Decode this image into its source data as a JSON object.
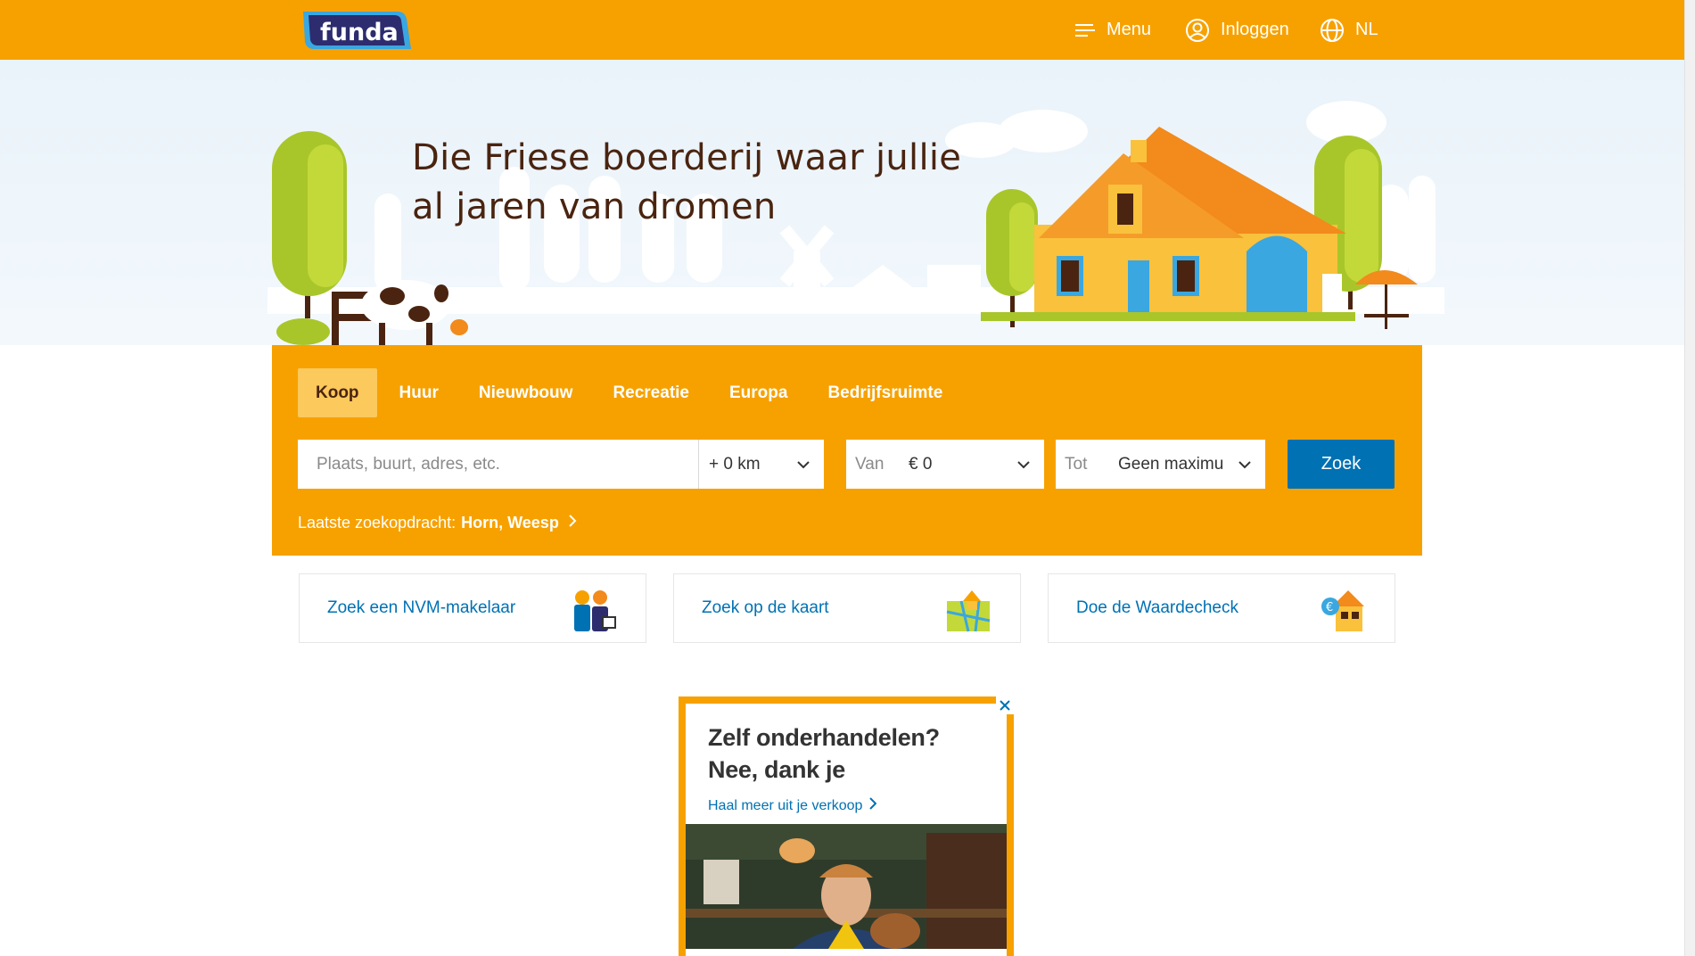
{
  "header": {
    "logo_text": "funda",
    "menu_label": "Menu",
    "login_label": "Inloggen",
    "language_label": "NL"
  },
  "hero": {
    "headline_line1": "Die Friese boerderij waar jullie",
    "headline_line2": "al jaren van dromen"
  },
  "search": {
    "tabs": [
      {
        "label": "Koop",
        "active": true
      },
      {
        "label": "Huur",
        "active": false
      },
      {
        "label": "Nieuwbouw",
        "active": false
      },
      {
        "label": "Recreatie",
        "active": false
      },
      {
        "label": "Europa",
        "active": false
      },
      {
        "label": "Bedrijfsruimte",
        "active": false
      }
    ],
    "query_placeholder": "Plaats, buurt, adres, etc.",
    "radius_value": "+ 0 km",
    "price_from_label": "Van",
    "price_from_value": "€ 0",
    "price_to_label": "Tot",
    "price_to_value": "Geen maximu",
    "submit_label": "Zoek",
    "last_search_label": "Laatste zoekopdracht:",
    "last_search_value": "Horn, Weesp"
  },
  "quick_links": [
    {
      "label": "Zoek een NVM-makelaar",
      "icon": "agents-icon"
    },
    {
      "label": "Zoek op de kaart",
      "icon": "map-house-icon"
    },
    {
      "label": "Doe de Waardecheck",
      "icon": "house-value-icon"
    }
  ],
  "ad": {
    "title_line1": "Zelf onderhandelen?",
    "title_line2": "Nee, dank je",
    "link_label": "Haal meer uit je verkoop"
  },
  "colors": {
    "brand_orange": "#f7a100",
    "link_blue": "#0071b3",
    "headline_brown": "#4a2410",
    "active_tab": "#fbc95c"
  }
}
